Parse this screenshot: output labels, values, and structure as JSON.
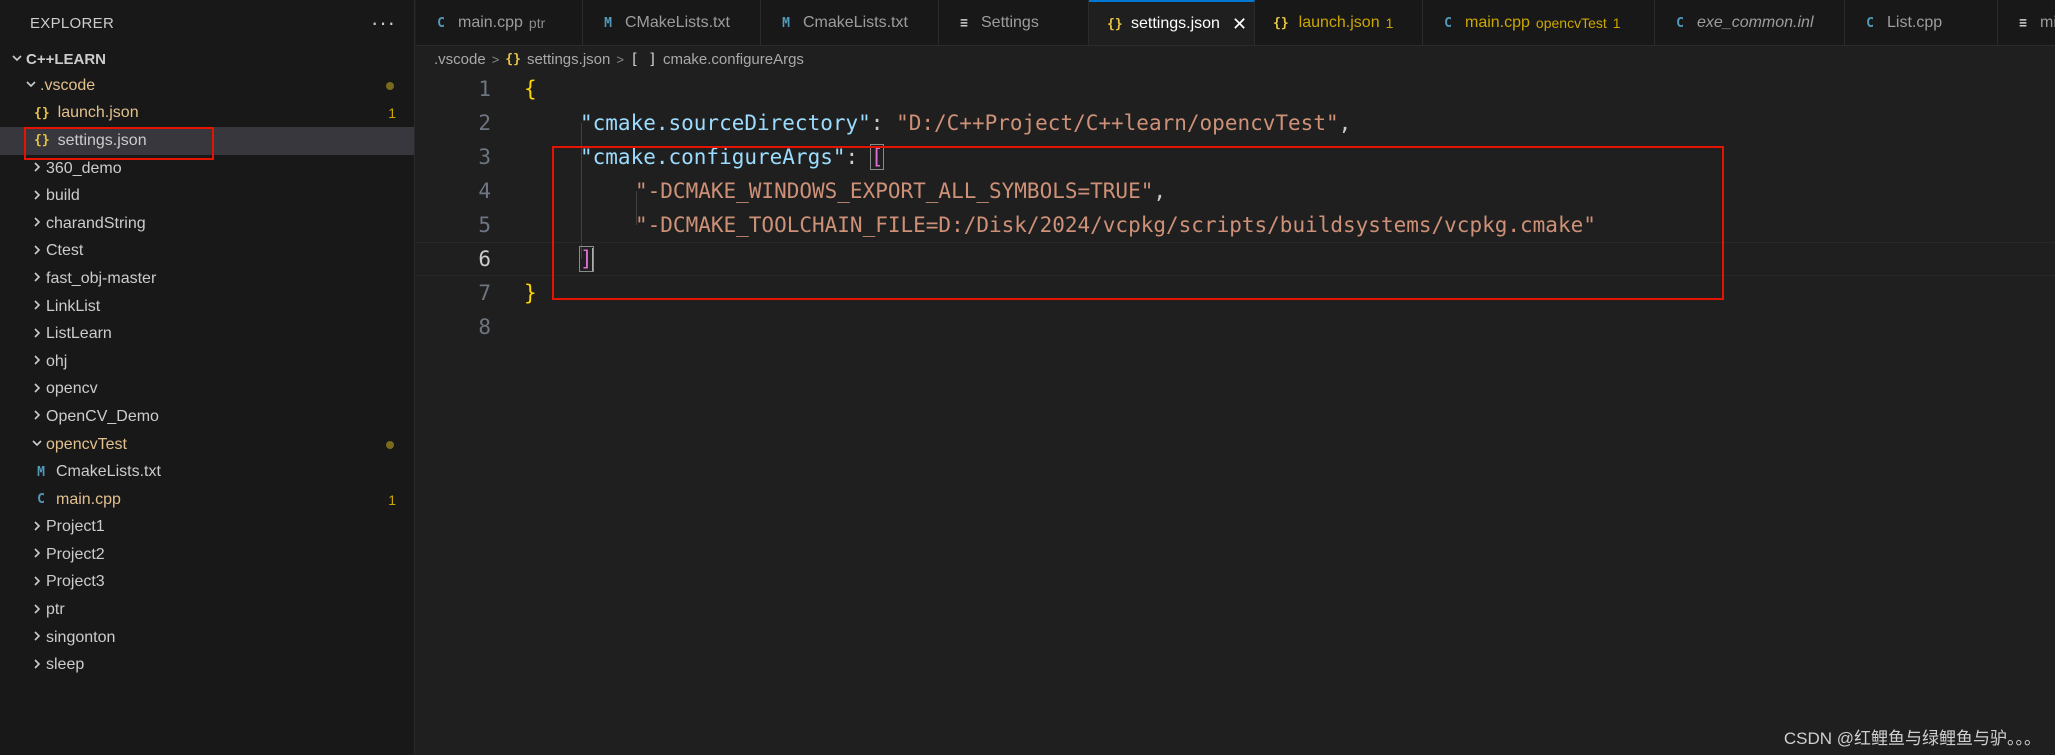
{
  "explorer": {
    "title": "EXPLORER",
    "more": "···",
    "root": "C++LEARN",
    "items": [
      {
        "label": ".vscode",
        "type": "folder",
        "open": true,
        "modified": true
      },
      {
        "label": "launch.json",
        "type": "json",
        "badge": "1",
        "modified": true
      },
      {
        "label": "settings.json",
        "type": "json",
        "selected": true
      },
      {
        "label": "360_demo",
        "type": "folder"
      },
      {
        "label": "build",
        "type": "folder"
      },
      {
        "label": "charandString",
        "type": "folder"
      },
      {
        "label": "Ctest",
        "type": "folder"
      },
      {
        "label": "fast_obj-master",
        "type": "folder"
      },
      {
        "label": "LinkList",
        "type": "folder"
      },
      {
        "label": "ListLearn",
        "type": "folder"
      },
      {
        "label": "ohj",
        "type": "folder"
      },
      {
        "label": "opencv",
        "type": "folder"
      },
      {
        "label": "OpenCV_Demo",
        "type": "folder"
      },
      {
        "label": "opencvTest",
        "type": "folder",
        "open": true,
        "modified": true
      },
      {
        "label": "CmakeLists.txt",
        "type": "cmake"
      },
      {
        "label": "main.cpp",
        "type": "cpp",
        "badge": "1",
        "modified": true
      },
      {
        "label": "Project1",
        "type": "folder"
      },
      {
        "label": "Project2",
        "type": "folder"
      },
      {
        "label": "Project3",
        "type": "folder"
      },
      {
        "label": "ptr",
        "type": "folder"
      },
      {
        "label": "singonton",
        "type": "folder"
      },
      {
        "label": "sleep",
        "type": "folder"
      }
    ]
  },
  "tabs": [
    {
      "label": "main.cpp",
      "desc": "ptr",
      "icon": "C"
    },
    {
      "label": "CMakeLists.txt",
      "icon": "M"
    },
    {
      "label": "CmakeLists.txt",
      "icon": "M"
    },
    {
      "label": "Settings",
      "icon": "≡"
    },
    {
      "label": "settings.json",
      "icon": "{}",
      "active": true,
      "close": "✕"
    },
    {
      "label": "launch.json",
      "icon": "{}",
      "count": "1"
    },
    {
      "label": "main.cpp",
      "desc": "opencvTest",
      "icon": "C",
      "count": "1"
    },
    {
      "label": "exe_common.inl",
      "icon": "C",
      "italic": true
    },
    {
      "label": "List.cpp",
      "icon": "C"
    },
    {
      "label": "mi",
      "icon": "≡"
    }
  ],
  "breadcrumb": {
    "folder": ".vscode",
    "file": "settings.json",
    "symbol": "cmake.configureArgs",
    "sep": ">",
    "array_icon": "[ ]",
    "json_icon": "{}"
  },
  "editor": {
    "line_numbers": [
      "1",
      "2",
      "3",
      "4",
      "5",
      "6",
      "7",
      "8"
    ],
    "current_line": "6",
    "brace_open": "{",
    "brace_close": "}",
    "key1": "\"cmake.sourceDirectory\"",
    "colon": ": ",
    "val1": "\"D:/C++Project/C++learn/opencvTest\"",
    "comma": ",",
    "key2": "\"cmake.configureArgs\"",
    "bracket_open": "[",
    "bracket_close": "]",
    "arg1": "\"-DCMAKE_WINDOWS_EXPORT_ALL_SYMBOLS=TRUE\"",
    "arg2": "\"-DCMAKE_TOOLCHAIN_FILE=D:/Disk/2024/vcpkg/scripts/buildsystems/vcpkg.cmake\""
  },
  "watermark": "CSDN @红鲤鱼与绿鲤鱼与驴。。。",
  "colors": {
    "accent": "#0078d4",
    "highlight_box": "#e51400",
    "warning": "#cca700",
    "json_icon": "#e8c547",
    "cmake_icon": "#519aba"
  }
}
